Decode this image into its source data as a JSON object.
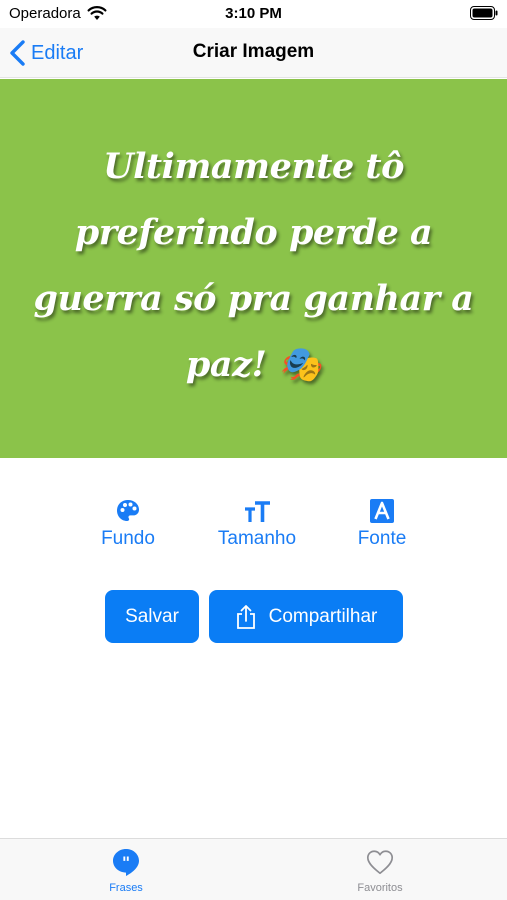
{
  "status_bar": {
    "carrier": "Operadora",
    "time": "3:10 PM"
  },
  "nav": {
    "back_label": "Editar",
    "title": "Criar Imagem"
  },
  "preview": {
    "background_color": "#8bc34a",
    "quote": "Ultimamente tô preferindo perde a guerra só pra ganhar a paz! 🎭"
  },
  "tools": [
    {
      "label": "Fundo",
      "icon": "palette-icon"
    },
    {
      "label": "Tamanho",
      "icon": "text-size-icon"
    },
    {
      "label": "Fonte",
      "icon": "font-icon"
    }
  ],
  "actions": {
    "save_label": "Salvar",
    "share_label": "Compartilhar"
  },
  "tab_bar": {
    "items": [
      {
        "label": "Frases",
        "icon": "quote-bubble-icon",
        "selected": true
      },
      {
        "label": "Favoritos",
        "icon": "heart-icon",
        "selected": false
      }
    ]
  },
  "colors": {
    "accent": "#1a7cf5",
    "button": "#0a7df5",
    "inactive_tab": "#8e8e93"
  }
}
